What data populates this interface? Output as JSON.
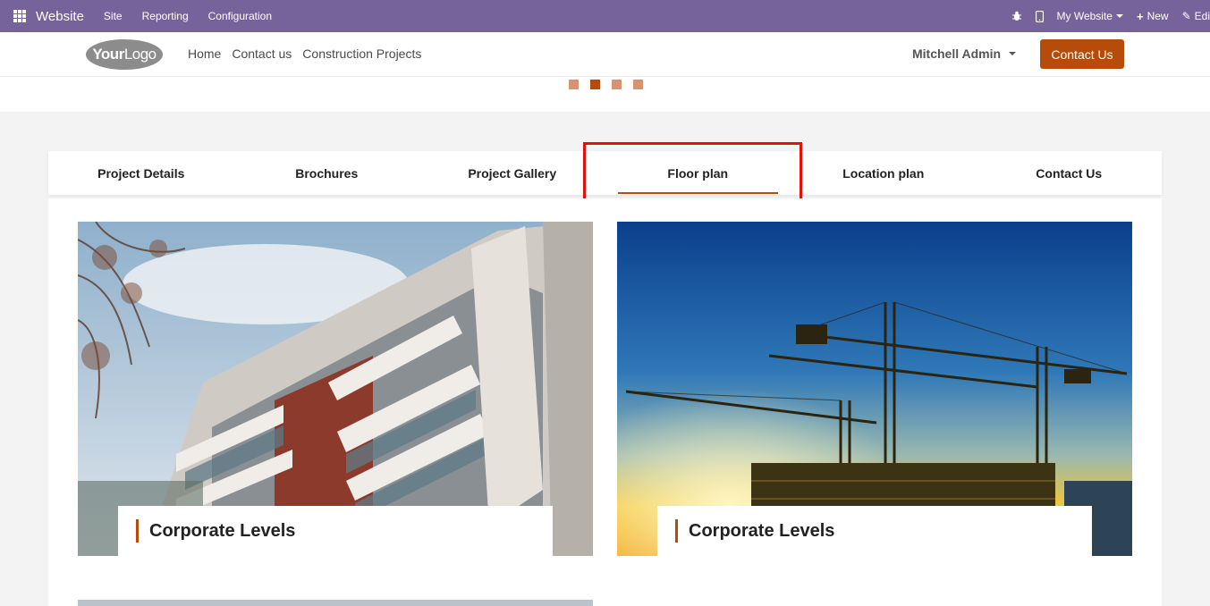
{
  "adminbar": {
    "brand": "Website",
    "menus": [
      "Site",
      "Reporting",
      "Configuration"
    ],
    "website_selector": "My Website",
    "new_label": "New",
    "edit_label": "Edi"
  },
  "header": {
    "logo_bold": "Your",
    "logo_light": "Logo",
    "nav": [
      "Home",
      "Contact us",
      "Construction Projects"
    ],
    "user": "Mitchell Admin",
    "contact_button": "Contact Us"
  },
  "tabs": [
    {
      "label": "Project Details",
      "active": false
    },
    {
      "label": "Brochures",
      "active": false
    },
    {
      "label": "Project Gallery",
      "active": false
    },
    {
      "label": "Floor plan",
      "active": true
    },
    {
      "label": "Location plan",
      "active": false
    },
    {
      "label": "Contact Us",
      "active": false
    }
  ],
  "cards": [
    {
      "title": "Corporate Levels",
      "image": "modern-apartment-building"
    },
    {
      "title": "Corporate Levels",
      "image": "construction-cranes-sunset"
    }
  ],
  "carousel": {
    "slides": 4,
    "active_index": 1
  },
  "colors": {
    "admin_bar": "#76639b",
    "accent": "#b74c0a",
    "highlight": "#e41010"
  }
}
